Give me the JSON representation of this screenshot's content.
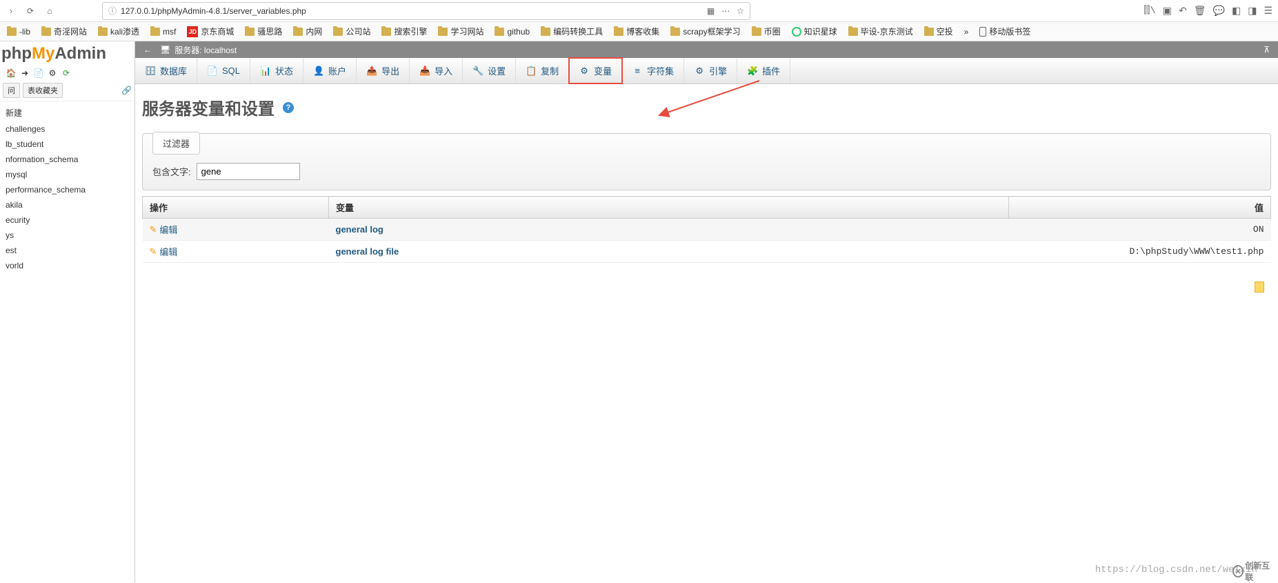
{
  "browser": {
    "url": "127.0.0.1/phpMyAdmin-4.8.1/server_variables.php"
  },
  "bookmarks": [
    {
      "type": "folder",
      "label": "-lib"
    },
    {
      "type": "folder",
      "label": "奇淫网站"
    },
    {
      "type": "folder",
      "label": "kali渗透"
    },
    {
      "type": "folder",
      "label": "msf"
    },
    {
      "type": "jd",
      "label": "京东商城"
    },
    {
      "type": "folder",
      "label": "骚思路"
    },
    {
      "type": "folder",
      "label": "内网"
    },
    {
      "type": "folder",
      "label": "公司站"
    },
    {
      "type": "folder",
      "label": "搜索引擎"
    },
    {
      "type": "folder",
      "label": "学习网站"
    },
    {
      "type": "folder",
      "label": "github"
    },
    {
      "type": "folder",
      "label": "编码转换工具"
    },
    {
      "type": "folder",
      "label": "博客收集"
    },
    {
      "type": "folder",
      "label": "scrapy框架学习"
    },
    {
      "type": "folder",
      "label": "币圈"
    },
    {
      "type": "green",
      "label": "知识星球"
    },
    {
      "type": "folder",
      "label": "毕设-京东测试"
    },
    {
      "type": "folder",
      "label": "空投"
    },
    {
      "type": "mobile",
      "label": "移动版书签"
    }
  ],
  "sidebar": {
    "logo_php": "php",
    "logo_my": "My",
    "logo_admin": "Admin",
    "filter_near": "问",
    "filter_fav": "表收藏夹",
    "new": "新建",
    "databases": [
      "challenges",
      "lb_student",
      "nformation_schema",
      "mysql",
      "performance_schema",
      "akila",
      "ecurity",
      "ys",
      "est",
      "vorld"
    ]
  },
  "server_bar": {
    "label": "服务器: localhost"
  },
  "tabs": [
    {
      "icon": "db",
      "label": "数据库"
    },
    {
      "icon": "sql",
      "label": "SQL"
    },
    {
      "icon": "status",
      "label": "状态"
    },
    {
      "icon": "users",
      "label": "账户"
    },
    {
      "icon": "export",
      "label": "导出"
    },
    {
      "icon": "import",
      "label": "导入"
    },
    {
      "icon": "settings",
      "label": "设置"
    },
    {
      "icon": "copy",
      "label": "复制"
    },
    {
      "icon": "vars",
      "label": "变量",
      "highlighted": true
    },
    {
      "icon": "charset",
      "label": "字符集"
    },
    {
      "icon": "engine",
      "label": "引擎"
    },
    {
      "icon": "plugin",
      "label": "插件"
    }
  ],
  "page": {
    "title": "服务器变量和设置",
    "filter_legend": "过滤器",
    "filter_label": "包含文字:",
    "filter_value": "gene",
    "table": {
      "col_action": "操作",
      "col_variable": "变量",
      "col_value": "值",
      "edit_label": "编辑",
      "rows": [
        {
          "var": "general log",
          "val": "ON"
        },
        {
          "var": "general log file",
          "val": "D:\\phpStudy\\WWW\\test1.php"
        }
      ]
    }
  },
  "watermark": "https://blog.csdn.net/weixin",
  "corner": "创新互联"
}
